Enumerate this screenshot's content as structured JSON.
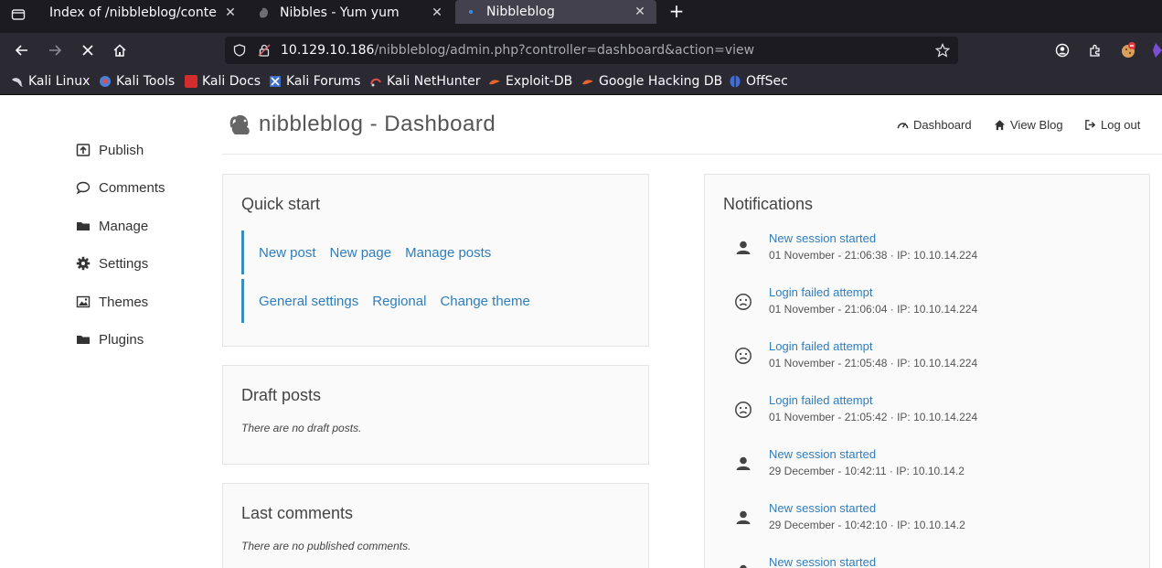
{
  "browser": {
    "tabs": [
      {
        "title": "Index of /nibbleblog/content",
        "active": false
      },
      {
        "title": "Nibbles - Yum yum",
        "active": false
      },
      {
        "title": "Nibbleblog",
        "active": true
      }
    ],
    "url_host": "10.129.10.186",
    "url_path": "/nibbleblog/admin.php?controller=dashboard&action=view",
    "bookmarks": [
      "Kali Linux",
      "Kali Tools",
      "Kali Docs",
      "Kali Forums",
      "Kali NetHunter",
      "Exploit-DB",
      "Google Hacking DB",
      "OffSec"
    ]
  },
  "header": {
    "title": "nibbleblog - Dashboard",
    "links": {
      "dashboard": "Dashboard",
      "view_blog": "View Blog",
      "logout": "Log out"
    }
  },
  "sidebar": {
    "items": [
      {
        "label": "Publish",
        "icon": "publish-icon"
      },
      {
        "label": "Comments",
        "icon": "comment-icon"
      },
      {
        "label": "Manage",
        "icon": "folder-icon"
      },
      {
        "label": "Settings",
        "icon": "gear-icon"
      },
      {
        "label": "Themes",
        "icon": "image-icon"
      },
      {
        "label": "Plugins",
        "icon": "folder-icon"
      }
    ]
  },
  "quick_start": {
    "title": "Quick start",
    "row1": [
      "New post",
      "New page",
      "Manage posts"
    ],
    "row2": [
      "General settings",
      "Regional",
      "Change theme"
    ]
  },
  "draft_posts": {
    "title": "Draft posts",
    "empty": "There are no draft posts."
  },
  "last_comments": {
    "title": "Last comments",
    "empty": "There are no published comments."
  },
  "notifications": {
    "title": "Notifications",
    "items": [
      {
        "title": "New session started",
        "meta": "01 November - 21:06:38 · IP: 10.10.14.224",
        "icon": "user-icon"
      },
      {
        "title": "Login failed attempt",
        "meta": "01 November - 21:06:04 · IP: 10.10.14.224",
        "icon": "sad-face-icon"
      },
      {
        "title": "Login failed attempt",
        "meta": "01 November - 21:05:48 · IP: 10.10.14.224",
        "icon": "sad-face-icon"
      },
      {
        "title": "Login failed attempt",
        "meta": "01 November - 21:05:42 · IP: 10.10.14.224",
        "icon": "sad-face-icon"
      },
      {
        "title": "New session started",
        "meta": "29 December - 10:42:11 · IP: 10.10.14.2",
        "icon": "user-icon"
      },
      {
        "title": "New session started",
        "meta": "29 December - 10:42:10 · IP: 10.10.14.2",
        "icon": "user-icon"
      },
      {
        "title": "New session started",
        "meta": "",
        "icon": "user-icon"
      }
    ]
  },
  "colors": {
    "link": "#2f7dbd",
    "accent_border": "#3c8dbc",
    "chrome_dark": "#1c1b22",
    "chrome": "#2b2a33"
  }
}
